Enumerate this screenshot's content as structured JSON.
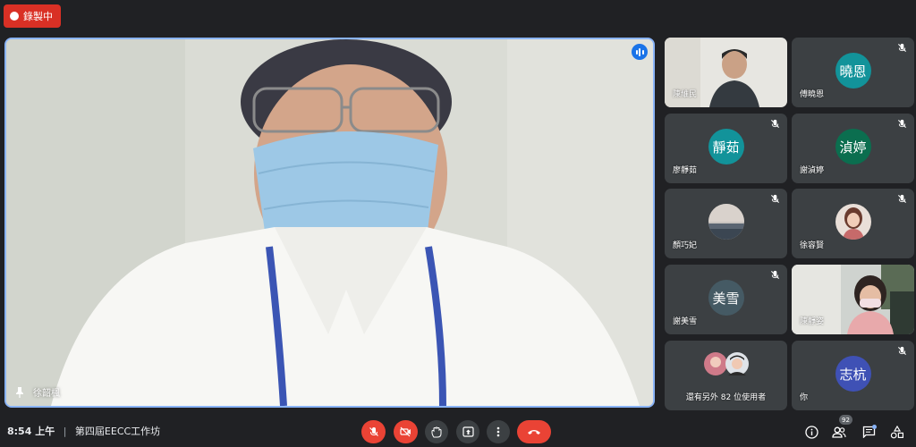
{
  "recording": {
    "label": "錄製中"
  },
  "main_speaker": {
    "name": "徐韶楓"
  },
  "tiles": [
    {
      "name": "陳維民",
      "type": "video",
      "muted": false
    },
    {
      "name": "傅曉恩",
      "type": "initials",
      "initials": "曉恩",
      "color": "#12939a",
      "muted": true
    },
    {
      "name": "廖靜茹",
      "type": "initials",
      "initials": "靜茹",
      "color": "#12939a",
      "muted": true
    },
    {
      "name": "謝湞婷",
      "type": "initials",
      "initials": "湞婷",
      "color": "#0b6e4f",
      "muted": true
    },
    {
      "name": "顏巧妃",
      "type": "photo",
      "muted": true
    },
    {
      "name": "徐容賢",
      "type": "photo",
      "muted": true
    },
    {
      "name": "謝美雪",
      "type": "initials",
      "initials": "美雪",
      "color": "#455a64",
      "muted": true
    },
    {
      "name": "陳靜姿",
      "type": "video",
      "muted": false
    },
    {
      "name": "還有另外 82 位使用者",
      "type": "others"
    },
    {
      "name": "你",
      "type": "initials",
      "initials": "志杭",
      "color": "#3f51b5",
      "muted": true
    }
  ],
  "footer": {
    "time": "8:54 上午",
    "separator": "|",
    "meeting_title": "第四屆EECC工作坊"
  },
  "participants_count": "92",
  "colors": {
    "accent": "#8ab4f8",
    "danger": "#ea4335",
    "tile_bg": "#3c4043",
    "background": "#202124"
  },
  "controls": [
    {
      "name": "mic-off-button",
      "icon": "mic-off-icon"
    },
    {
      "name": "camera-off-button",
      "icon": "videocam-off-icon"
    },
    {
      "name": "raise-hand-button",
      "icon": "hand-icon"
    },
    {
      "name": "present-button",
      "icon": "present-icon"
    },
    {
      "name": "more-options-button",
      "icon": "more-vert-icon"
    },
    {
      "name": "leave-call-button",
      "icon": "call-end-icon"
    }
  ],
  "side_actions": [
    "info-icon",
    "people-icon",
    "chat-icon",
    "activities-icon"
  ]
}
